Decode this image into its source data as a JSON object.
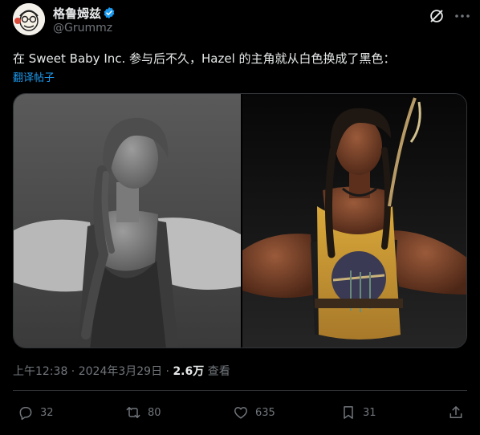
{
  "author": {
    "display_name": "格鲁姆兹",
    "handle": "@Grummz",
    "verified": true
  },
  "tweet": {
    "text": "在 Sweet Baby Inc. 参与后不久，Hazel 的主角就从白色换成了黑色：",
    "translate_label": "翻译帖子"
  },
  "meta": {
    "time": "上午12:38",
    "separator1": " · ",
    "date": "2024年3月29日",
    "separator2": " · ",
    "views_count": "2.6万",
    "views_label": " 查看"
  },
  "actions": {
    "replies": "32",
    "reposts": "80",
    "likes": "635",
    "bookmarks": "31"
  },
  "icons": {
    "verified": "verified-badge-icon",
    "grok": "grok-icon",
    "more": "more-icon",
    "reply": "reply-icon",
    "repost": "repost-icon",
    "like": "heart-icon",
    "bookmark": "bookmark-icon",
    "share": "share-icon"
  },
  "colors": {
    "background": "#000000",
    "text": "#e7e9ea",
    "secondary": "#71767b",
    "accent": "#1d9bf0",
    "border": "#2f3336"
  }
}
